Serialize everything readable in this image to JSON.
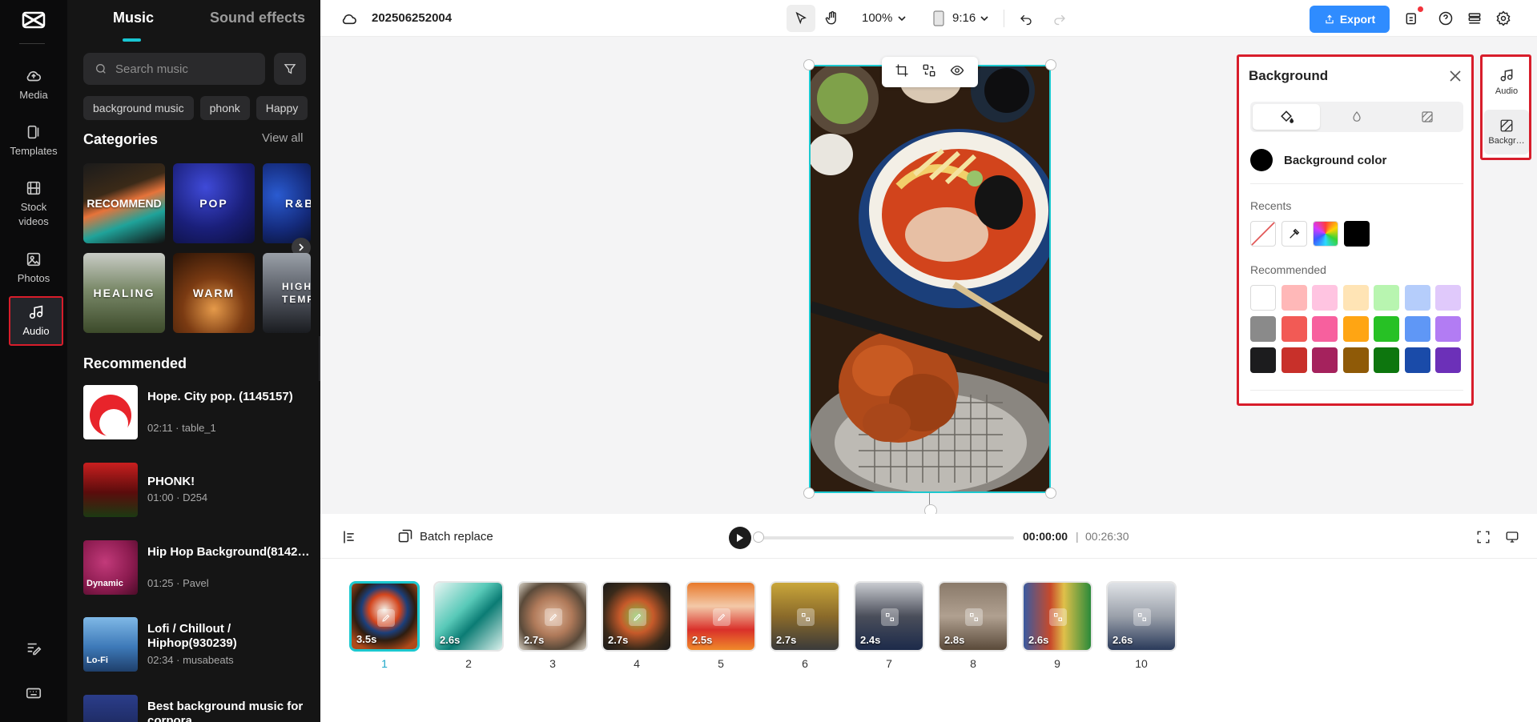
{
  "rail": {
    "items": [
      {
        "label": "Media",
        "icon": "cloud-upload-icon"
      },
      {
        "label": "Templates",
        "icon": "templates-icon"
      },
      {
        "label": "Stock videos",
        "icon": "film-icon"
      },
      {
        "label": "Photos",
        "icon": "image-icon"
      },
      {
        "label": "Audio",
        "icon": "music-note-icon",
        "active": true
      }
    ]
  },
  "music_panel": {
    "tabs": [
      "Music",
      "Sound effects"
    ],
    "search_placeholder": "Search music",
    "chips": [
      "background music",
      "phonk",
      "Happy"
    ],
    "categories_title": "Categories",
    "view_all": "View all",
    "categories": [
      "RECOMMEND",
      "POP",
      "R&B",
      "HEALING",
      "WARM",
      "HIGH TEMPO"
    ],
    "recommended_title": "Recommended",
    "recommended": [
      {
        "title": "Hope. City pop. (1145157)",
        "meta": "02:11 · table_1"
      },
      {
        "title": "PHONK!",
        "meta": "01:00 · D254"
      },
      {
        "title": "Hip Hop Background(8142…",
        "meta": "01:25 · Pavel",
        "badge": "Dynamic"
      },
      {
        "title": "Lofi / Chillout / Hiphop(930239)",
        "meta": "02:34 · musabeats",
        "badge": "Lo-Fi"
      },
      {
        "title": "Best background music for corpora…",
        "meta": ""
      }
    ]
  },
  "topbar": {
    "project_name": "202506252004",
    "zoom": "100%",
    "ratio": "9:16",
    "export_label": "Export"
  },
  "background_panel": {
    "title": "Background",
    "color_label": "Background color",
    "recents_label": "Recents",
    "recommended_label": "Recommended",
    "recents": [
      "transparent",
      "eyedropper",
      "gradient",
      "#000000"
    ],
    "swatches": [
      [
        "#ffffff",
        "#ffb8b8",
        "#ffc4e1",
        "#ffe4b5",
        "#b8f5b0",
        "#b5cdfb",
        "#e0c9fb"
      ],
      [
        "#8a8a8a",
        "#f25a55",
        "#f7609e",
        "#ffa513",
        "#27c125",
        "#5f97f6",
        "#b27cf3"
      ],
      [
        "#1c1c1e",
        "#c8302a",
        "#a5225d",
        "#8f5a07",
        "#0d760e",
        "#1a4ba9",
        "#6c30b8"
      ]
    ]
  },
  "mini_sidebar": {
    "items": [
      {
        "label": "Audio",
        "icon": "music-note-icon"
      },
      {
        "label": "Backgr…",
        "icon": "background-icon",
        "active": true
      }
    ]
  },
  "timeline": {
    "batch_replace": "Batch replace",
    "current_time": "00:00:00",
    "separator": "|",
    "total_time": "00:26:30",
    "clips": [
      {
        "num": "1",
        "duration": "3.5s",
        "active": true
      },
      {
        "num": "2",
        "duration": "2.6s"
      },
      {
        "num": "3",
        "duration": "2.7s"
      },
      {
        "num": "4",
        "duration": "2.7s"
      },
      {
        "num": "5",
        "duration": "2.5s"
      },
      {
        "num": "6",
        "duration": "2.7s"
      },
      {
        "num": "7",
        "duration": "2.4s"
      },
      {
        "num": "8",
        "duration": "2.8s"
      },
      {
        "num": "9",
        "duration": "2.6s"
      },
      {
        "num": "10",
        "duration": "2.6s"
      }
    ]
  },
  "colors": {
    "accent": "#1cc8cf",
    "export": "#2f8cff",
    "highlight": "#d81d2b"
  }
}
